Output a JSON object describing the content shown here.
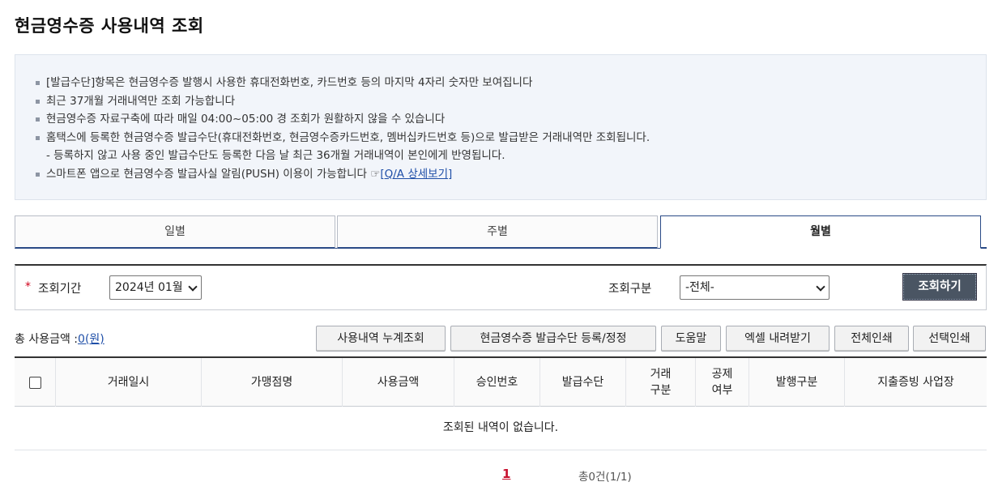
{
  "page": {
    "title": "현금영수증 사용내역 조회"
  },
  "notice": {
    "items": [
      "[발급수단]항목은 현금영수증 발행시 사용한 휴대전화번호, 카드번호 등의 마지막 4자리 숫자만 보여집니다",
      "최근 37개월 거래내역만 조회 가능합니다",
      "현금영수증 자료구축에 따라 매일 04:00~05:00 경 조회가 원활하지 않을 수 있습니다",
      "홈택스에 등록한 현금영수증 발급수단(휴대전화번호, 현금영수증카드번호, 멤버십카드번호 등)으로 발급받은 거래내역만 조회됩니다."
    ],
    "sub_item": "- 등록하지 않고 사용 중인 발급수단도 등록한 다음 날 최근 36개월 거래내역이 본인에게 반영됩니다.",
    "push_text": "스마트폰 앱으로 현금영수증 발급사실 알림(PUSH) 이용이 가능합니다",
    "hand_glyph": "☞",
    "qa_link": "[Q/A 상세보기]"
  },
  "tabs": [
    {
      "label": "일별"
    },
    {
      "label": "주별"
    },
    {
      "label": "월별",
      "active": true
    }
  ],
  "search": {
    "required_mark": "*",
    "period_label": "조회기간",
    "period_value": "2024년 01월",
    "type_label": "조회구분",
    "type_value": "-전체-",
    "submit_label": "조회하기"
  },
  "summary": {
    "total_label": "총 사용금액 :",
    "total_amount": "0(원)"
  },
  "actions": {
    "cumulative": "사용내역 누계조회",
    "register": "현금영수증 발급수단 등록/정정",
    "help": "도움말",
    "excel": "엑셀 내려받기",
    "print_all": "전체인쇄",
    "print_selected": "선택인쇄"
  },
  "table": {
    "columns": [
      "거래일시",
      "가맹점명",
      "사용금액",
      "승인번호",
      "발급수단",
      "거래\n구분",
      "공제\n여부",
      "발행구분",
      "지출증빙 사업장"
    ],
    "empty_message": "조회된 내역이 없습니다."
  },
  "pagination": {
    "current_page": "1",
    "count_text": "총0건(1/1)"
  },
  "colors": {
    "accent": "#2a4a86",
    "search_button": "#4a5563",
    "required": "#d0021b",
    "current_page": "#c8102e",
    "notice_bg": "#f2f5fa"
  }
}
